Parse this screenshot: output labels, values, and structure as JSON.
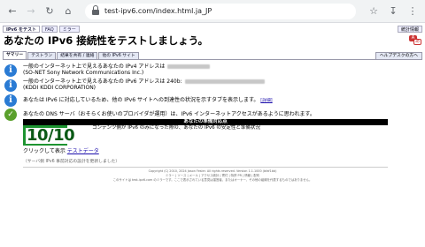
{
  "browser": {
    "url": "test-ipv6.com/index.html.ja_JP"
  },
  "topbar": {
    "tabs": [
      "IPv6 をテスト",
      "FAQ",
      "ミラー"
    ],
    "feedback": "統計情報"
  },
  "page_title": "あなたの IPv6 接続性をテストしましょう。",
  "tabs": [
    "サマリー",
    "テストラン",
    "結果を共有 / 連絡",
    "他の IPv6 サイト"
  ],
  "help_tab": "ヘルプデスクの方へ",
  "results": [
    {
      "type": "info",
      "line1": "一般のインターネット上で見えるあなたの IPv4 アドレスは",
      "line2": "(SO-NET Sony Network Communications Inc.)"
    },
    {
      "type": "info",
      "line1": "一般のインターネット上で見えるあなたの IPv6 アドレスは 240b:",
      "line2": "(KDDI KDDI CORPORATION)"
    },
    {
      "type": "info",
      "line1": "あなたは IPv6 に対応しているため、他の IPv6 サイトへの到達性の状況を示すタブを表示します。",
      "link": "[詳細]"
    },
    {
      "type": "ok",
      "line1": "あなたの DNS サーバ（おそらくお使いのプロバイダが運用）は、IPv6 インターネットアクセスがあるように思われます。"
    }
  ],
  "score": {
    "header": "あなたの準備対応点",
    "value": "10/10",
    "description": "コンテンツ側が IPv6 のみになった際の、あなたの IPv6 の安定性と準備状況"
  },
  "click_show": {
    "label": "クリックして表示",
    "link": "テストデータ"
  },
  "config_note": "（サーバ側 IPv6 事前対応の設計を更新しました）",
  "footer": {
    "line1": "Copyright (C) 2010, 2024 Jason Fesler. All rights reserved. Version 1.1.1000 (bfaf1bb)",
    "line2": "ミラー | ソース | メール | アクセス統計 | 寄付 | 特許 PR | 情報 | 配布",
    "line3": "このサイトは test-ipv6.com のミラーです。ここで表示されている意見は運営者、またはオーナー、その他の組織を代表するものではありません。"
  }
}
